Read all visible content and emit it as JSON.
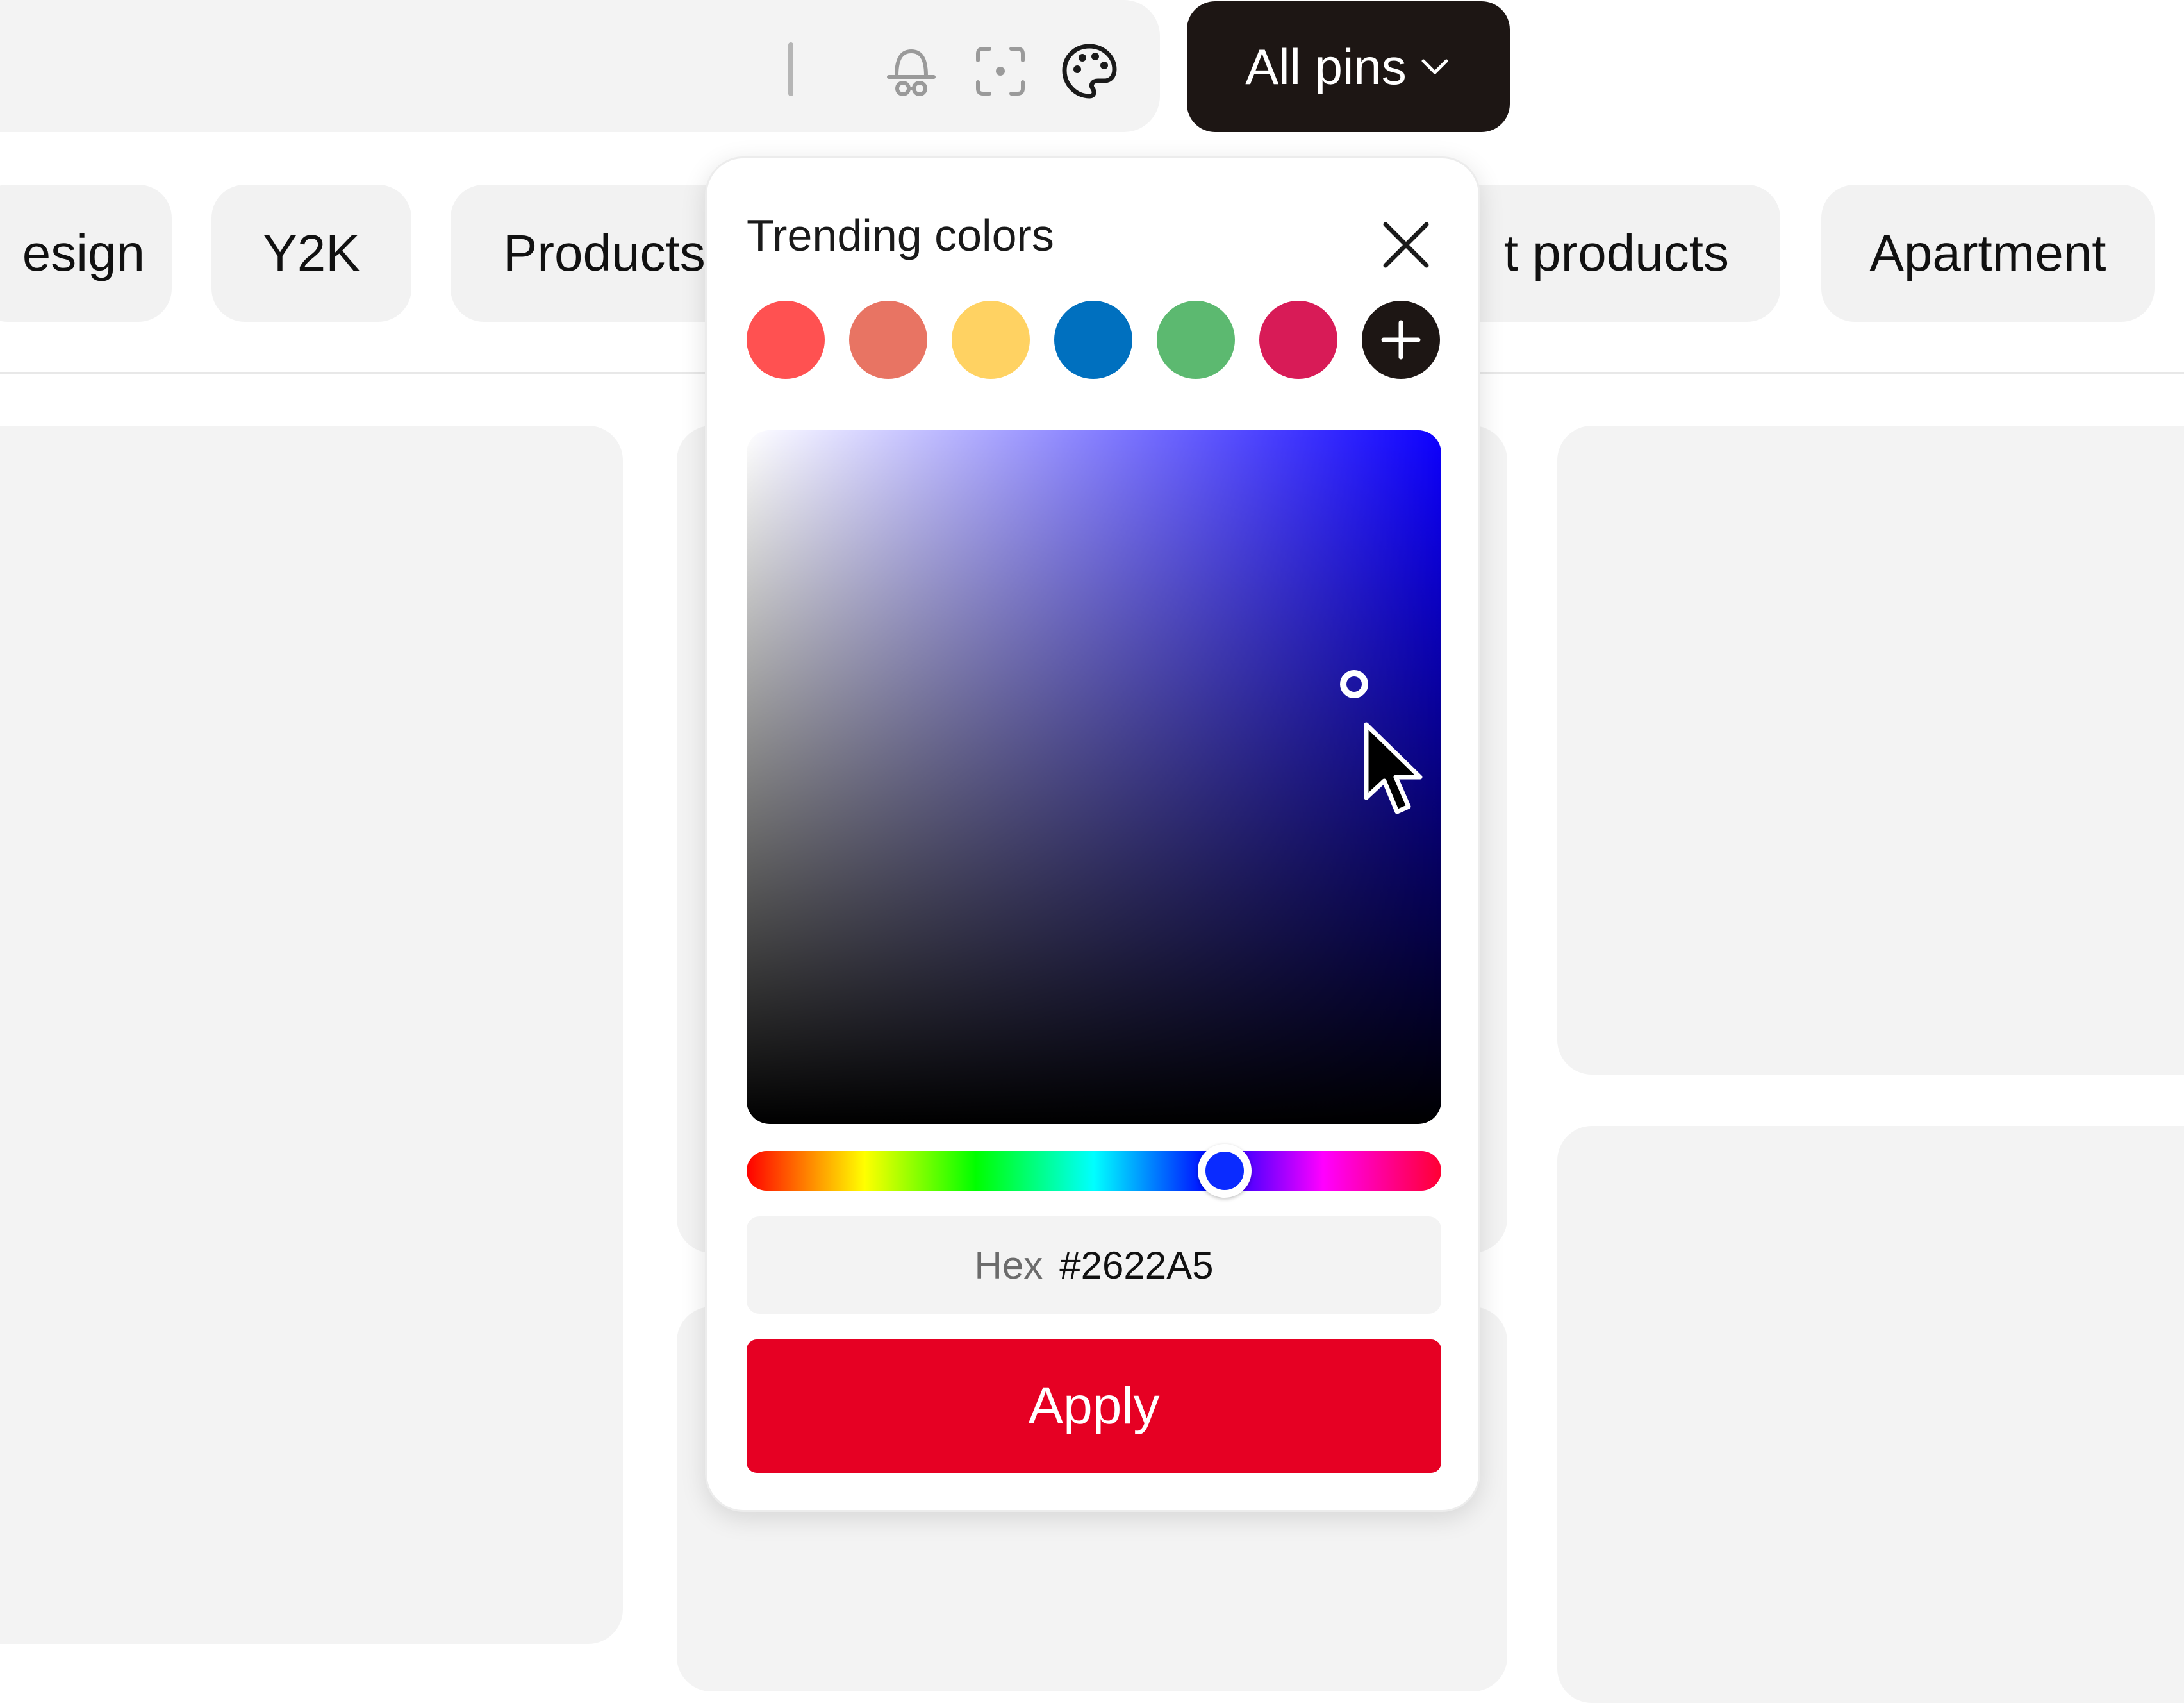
{
  "toolbar": {
    "pins_label": "All pins",
    "icons": [
      "incognito-icon",
      "lens-icon",
      "palette-icon",
      "chevron-down-icon"
    ]
  },
  "chips": [
    "esign",
    "Y2K",
    "Products",
    "t products",
    "Apartment"
  ],
  "color_picker": {
    "title": "Trending colors",
    "swatches": [
      "#ff5151",
      "#e87463",
      "#ffd262",
      "#0070bf",
      "#5cb970",
      "#d81b57"
    ],
    "add_icon": "plus-icon",
    "hex_label": "Hex",
    "hex_value": "#2622A5",
    "apply_label": "Apply"
  }
}
